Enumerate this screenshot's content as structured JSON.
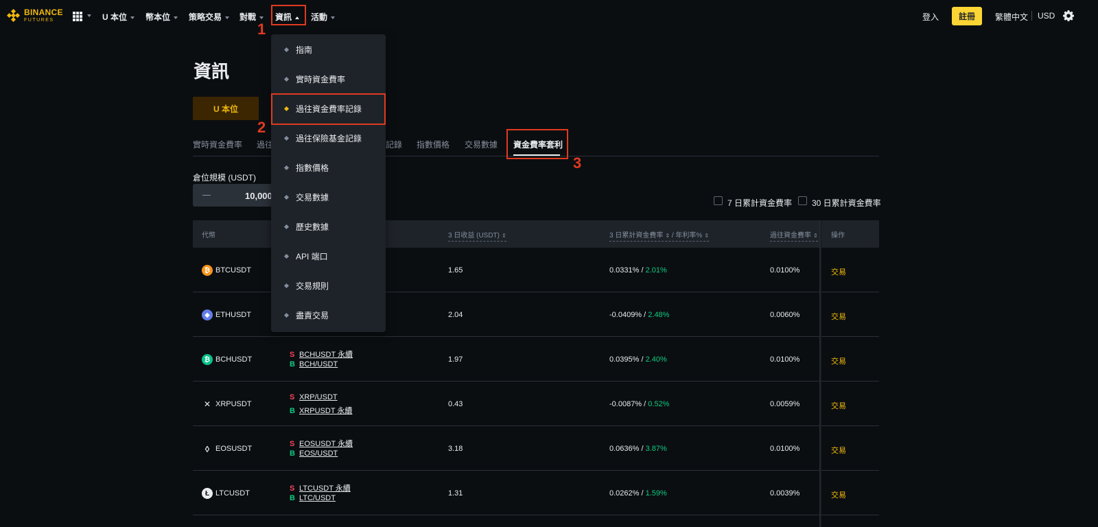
{
  "brand": {
    "name": "BINANCE",
    "sub": "FUTURES"
  },
  "nav": {
    "items": [
      {
        "label": "U 本位"
      },
      {
        "label": "幣本位"
      },
      {
        "label": "策略交易"
      },
      {
        "label": "對戰"
      },
      {
        "label": "資訊"
      },
      {
        "label": "活動"
      }
    ],
    "login": "登入",
    "register": "註冊",
    "language": "繁體中文",
    "currency": "USD"
  },
  "annotations": {
    "one": "1",
    "two": "2",
    "three": "3"
  },
  "dropdown": {
    "items": [
      {
        "label": "指南"
      },
      {
        "label": "實時資金費率"
      },
      {
        "label": "過往資金費率記錄"
      },
      {
        "label": "過往保險基金記錄"
      },
      {
        "label": "指數價格"
      },
      {
        "label": "交易數據"
      },
      {
        "label": "歷史數據"
      },
      {
        "label": "API 端口"
      },
      {
        "label": "交易規則"
      },
      {
        "label": "盡責交易"
      }
    ]
  },
  "page": {
    "title": "資訊",
    "contract_button": "U 本位",
    "tabs": [
      {
        "label": "實時資金費率"
      },
      {
        "label": "過往"
      },
      {
        "label": "記錄"
      },
      {
        "label": "指數價格"
      },
      {
        "label": "交易數據"
      },
      {
        "label": "資金費率套利"
      }
    ],
    "position_label": "倉位規模 (USDT)",
    "position_value": "10,000",
    "checkbox_7d": "7 日累計資金費率",
    "checkbox_30d": "30 日累計資金費率"
  },
  "table": {
    "headers": {
      "coin": "代幣",
      "profit": "3 日收益 (USDT)",
      "rate": "3 日累計資金費率",
      "apr": "/ 年利率%",
      "past": "過往資金費率",
      "action": "操作"
    },
    "rows": [
      {
        "coin": "BTCUSDT",
        "icon": "₿",
        "color": "#f7931a",
        "leg_top": "",
        "leg_bottom": "",
        "leg_top_side": "",
        "leg_bottom_side": "",
        "profit": "1.65",
        "rate": "0.0331% /",
        "apr": "2.01%",
        "past": "0.0100%",
        "action": "交易"
      },
      {
        "coin": "ETHUSDT",
        "icon": "◆",
        "color": "#627eea",
        "leg_top": "",
        "leg_bottom": "",
        "leg_top_side": "",
        "leg_bottom_side": "",
        "profit": "2.04",
        "rate": "-0.0409% /",
        "apr": "2.48%",
        "past": "0.0060%",
        "action": "交易"
      },
      {
        "coin": "BCHUSDT",
        "icon": "₿",
        "color": "#0ac18e",
        "leg_top": "BCHUSDT 永續",
        "leg_bottom": "BCH/USDT",
        "leg_top_side": "S",
        "leg_bottom_side": "B",
        "profit": "1.97",
        "rate": "0.0395% /",
        "apr": "2.40%",
        "past": "0.0100%",
        "action": "交易"
      },
      {
        "coin": "XRPUSDT",
        "icon": "✕",
        "color": "#23292f",
        "leg_top": "XRP/USDT",
        "leg_bottom": "XRPUSDT 永續",
        "leg_top_side": "S",
        "leg_bottom_side": "B",
        "profit": "0.43",
        "rate": "-0.0087% /",
        "apr": "0.52%",
        "past": "0.0059%",
        "action": "交易"
      },
      {
        "coin": "EOSUSDT",
        "icon": "◊",
        "color": "#0b0e11",
        "leg_top": "EOSUSDT 永續",
        "leg_bottom": "EOS/USDT",
        "leg_top_side": "S",
        "leg_bottom_side": "B",
        "profit": "3.18",
        "rate": "0.0636% /",
        "apr": "3.87%",
        "past": "0.0100%",
        "action": "交易"
      },
      {
        "coin": "LTCUSDT",
        "icon": "Ł",
        "color": "#eaecef",
        "leg_top": "LTCUSDT 永續",
        "leg_bottom": "LTC/USDT",
        "leg_top_side": "S",
        "leg_bottom_side": "B",
        "profit": "1.31",
        "rate": "0.0262% /",
        "apr": "1.59%",
        "past": "0.0039%",
        "action": "交易"
      }
    ]
  }
}
